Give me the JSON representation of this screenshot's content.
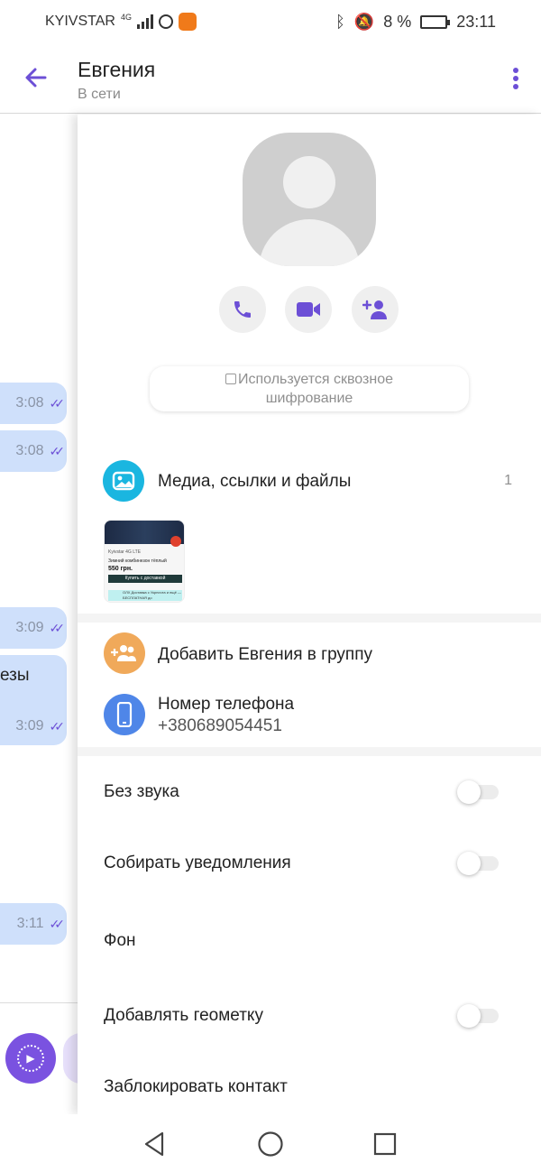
{
  "status_bar": {
    "carrier": "KYIVSTAR",
    "network": "4G",
    "battery": "8 %",
    "time": "23:11"
  },
  "header": {
    "title": "Евгения",
    "subtitle": "В сети"
  },
  "chat": {
    "bubbles": [
      {
        "time": "3:08"
      },
      {
        "time": "3:08"
      },
      {
        "time": "3:09"
      },
      {
        "text": "езы",
        "time": "3:09"
      },
      {
        "time": "3:11"
      }
    ],
    "ticks": "✓✓"
  },
  "panel": {
    "encryption_line1": "Используется сквозное",
    "encryption_line2": "шифрование",
    "media": {
      "label": "Медиа, ссылки и файлы",
      "count": "1",
      "thumb": {
        "line1": "Kyivstar 4G LTE",
        "line2": "Зимний комбинезон тёплый",
        "price": "550 грн.",
        "button": "Купить с доставкой",
        "info": "ОЛХ Доставка с Укрпочта и ещё — БЕСПЛАТНАЯ до"
      }
    },
    "add_to_group": "Добавить Евгения в группу",
    "phone": {
      "label": "Номер телефона",
      "number": "+380689054451"
    },
    "settings": {
      "mute": "Без звука",
      "collect_notifications": "Собирать уведомления",
      "background": "Фон",
      "add_geotag": "Добавлять геометку",
      "block": "Заблокировать контакт"
    },
    "toggles": {
      "mute": false,
      "collect_notifications": false,
      "add_geotag": false
    }
  },
  "icons": {
    "back": "arrow-left-icon",
    "menu": "more-vertical-icon",
    "call": "phone-icon",
    "video": "video-camera-icon",
    "add_contact": "add-user-icon",
    "lock": "lock-icon",
    "media": "image-icon",
    "group": "group-add-icon",
    "phone": "mobile-phone-icon"
  },
  "colors": {
    "accent": "#6c4fd6",
    "bubble": "#cfe0fb",
    "media_icon": "#1ab6e0",
    "group_icon": "#f0a95a",
    "phone_icon": "#4f86e8"
  }
}
